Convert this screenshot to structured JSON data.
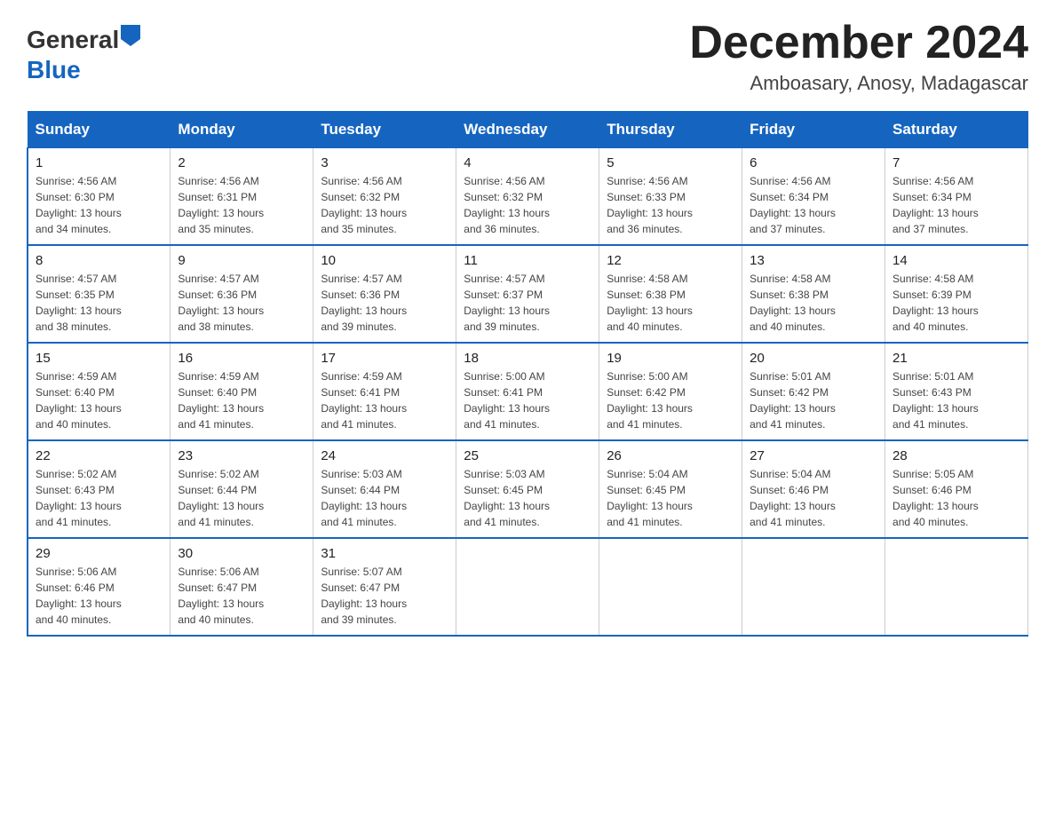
{
  "header": {
    "logo_general": "General",
    "logo_blue": "Blue",
    "month_title": "December 2024",
    "location": "Amboasary, Anosy, Madagascar"
  },
  "days_of_week": [
    "Sunday",
    "Monday",
    "Tuesday",
    "Wednesday",
    "Thursday",
    "Friday",
    "Saturday"
  ],
  "weeks": [
    [
      {
        "day": "1",
        "sunrise": "4:56 AM",
        "sunset": "6:30 PM",
        "daylight": "13 hours and 34 minutes."
      },
      {
        "day": "2",
        "sunrise": "4:56 AM",
        "sunset": "6:31 PM",
        "daylight": "13 hours and 35 minutes."
      },
      {
        "day": "3",
        "sunrise": "4:56 AM",
        "sunset": "6:32 PM",
        "daylight": "13 hours and 35 minutes."
      },
      {
        "day": "4",
        "sunrise": "4:56 AM",
        "sunset": "6:32 PM",
        "daylight": "13 hours and 36 minutes."
      },
      {
        "day": "5",
        "sunrise": "4:56 AM",
        "sunset": "6:33 PM",
        "daylight": "13 hours and 36 minutes."
      },
      {
        "day": "6",
        "sunrise": "4:56 AM",
        "sunset": "6:34 PM",
        "daylight": "13 hours and 37 minutes."
      },
      {
        "day": "7",
        "sunrise": "4:56 AM",
        "sunset": "6:34 PM",
        "daylight": "13 hours and 37 minutes."
      }
    ],
    [
      {
        "day": "8",
        "sunrise": "4:57 AM",
        "sunset": "6:35 PM",
        "daylight": "13 hours and 38 minutes."
      },
      {
        "day": "9",
        "sunrise": "4:57 AM",
        "sunset": "6:36 PM",
        "daylight": "13 hours and 38 minutes."
      },
      {
        "day": "10",
        "sunrise": "4:57 AM",
        "sunset": "6:36 PM",
        "daylight": "13 hours and 39 minutes."
      },
      {
        "day": "11",
        "sunrise": "4:57 AM",
        "sunset": "6:37 PM",
        "daylight": "13 hours and 39 minutes."
      },
      {
        "day": "12",
        "sunrise": "4:58 AM",
        "sunset": "6:38 PM",
        "daylight": "13 hours and 40 minutes."
      },
      {
        "day": "13",
        "sunrise": "4:58 AM",
        "sunset": "6:38 PM",
        "daylight": "13 hours and 40 minutes."
      },
      {
        "day": "14",
        "sunrise": "4:58 AM",
        "sunset": "6:39 PM",
        "daylight": "13 hours and 40 minutes."
      }
    ],
    [
      {
        "day": "15",
        "sunrise": "4:59 AM",
        "sunset": "6:40 PM",
        "daylight": "13 hours and 40 minutes."
      },
      {
        "day": "16",
        "sunrise": "4:59 AM",
        "sunset": "6:40 PM",
        "daylight": "13 hours and 41 minutes."
      },
      {
        "day": "17",
        "sunrise": "4:59 AM",
        "sunset": "6:41 PM",
        "daylight": "13 hours and 41 minutes."
      },
      {
        "day": "18",
        "sunrise": "5:00 AM",
        "sunset": "6:41 PM",
        "daylight": "13 hours and 41 minutes."
      },
      {
        "day": "19",
        "sunrise": "5:00 AM",
        "sunset": "6:42 PM",
        "daylight": "13 hours and 41 minutes."
      },
      {
        "day": "20",
        "sunrise": "5:01 AM",
        "sunset": "6:42 PM",
        "daylight": "13 hours and 41 minutes."
      },
      {
        "day": "21",
        "sunrise": "5:01 AM",
        "sunset": "6:43 PM",
        "daylight": "13 hours and 41 minutes."
      }
    ],
    [
      {
        "day": "22",
        "sunrise": "5:02 AM",
        "sunset": "6:43 PM",
        "daylight": "13 hours and 41 minutes."
      },
      {
        "day": "23",
        "sunrise": "5:02 AM",
        "sunset": "6:44 PM",
        "daylight": "13 hours and 41 minutes."
      },
      {
        "day": "24",
        "sunrise": "5:03 AM",
        "sunset": "6:44 PM",
        "daylight": "13 hours and 41 minutes."
      },
      {
        "day": "25",
        "sunrise": "5:03 AM",
        "sunset": "6:45 PM",
        "daylight": "13 hours and 41 minutes."
      },
      {
        "day": "26",
        "sunrise": "5:04 AM",
        "sunset": "6:45 PM",
        "daylight": "13 hours and 41 minutes."
      },
      {
        "day": "27",
        "sunrise": "5:04 AM",
        "sunset": "6:46 PM",
        "daylight": "13 hours and 41 minutes."
      },
      {
        "day": "28",
        "sunrise": "5:05 AM",
        "sunset": "6:46 PM",
        "daylight": "13 hours and 40 minutes."
      }
    ],
    [
      {
        "day": "29",
        "sunrise": "5:06 AM",
        "sunset": "6:46 PM",
        "daylight": "13 hours and 40 minutes."
      },
      {
        "day": "30",
        "sunrise": "5:06 AM",
        "sunset": "6:47 PM",
        "daylight": "13 hours and 40 minutes."
      },
      {
        "day": "31",
        "sunrise": "5:07 AM",
        "sunset": "6:47 PM",
        "daylight": "13 hours and 39 minutes."
      },
      null,
      null,
      null,
      null
    ]
  ],
  "labels": {
    "sunrise": "Sunrise:",
    "sunset": "Sunset:",
    "daylight": "Daylight:"
  }
}
